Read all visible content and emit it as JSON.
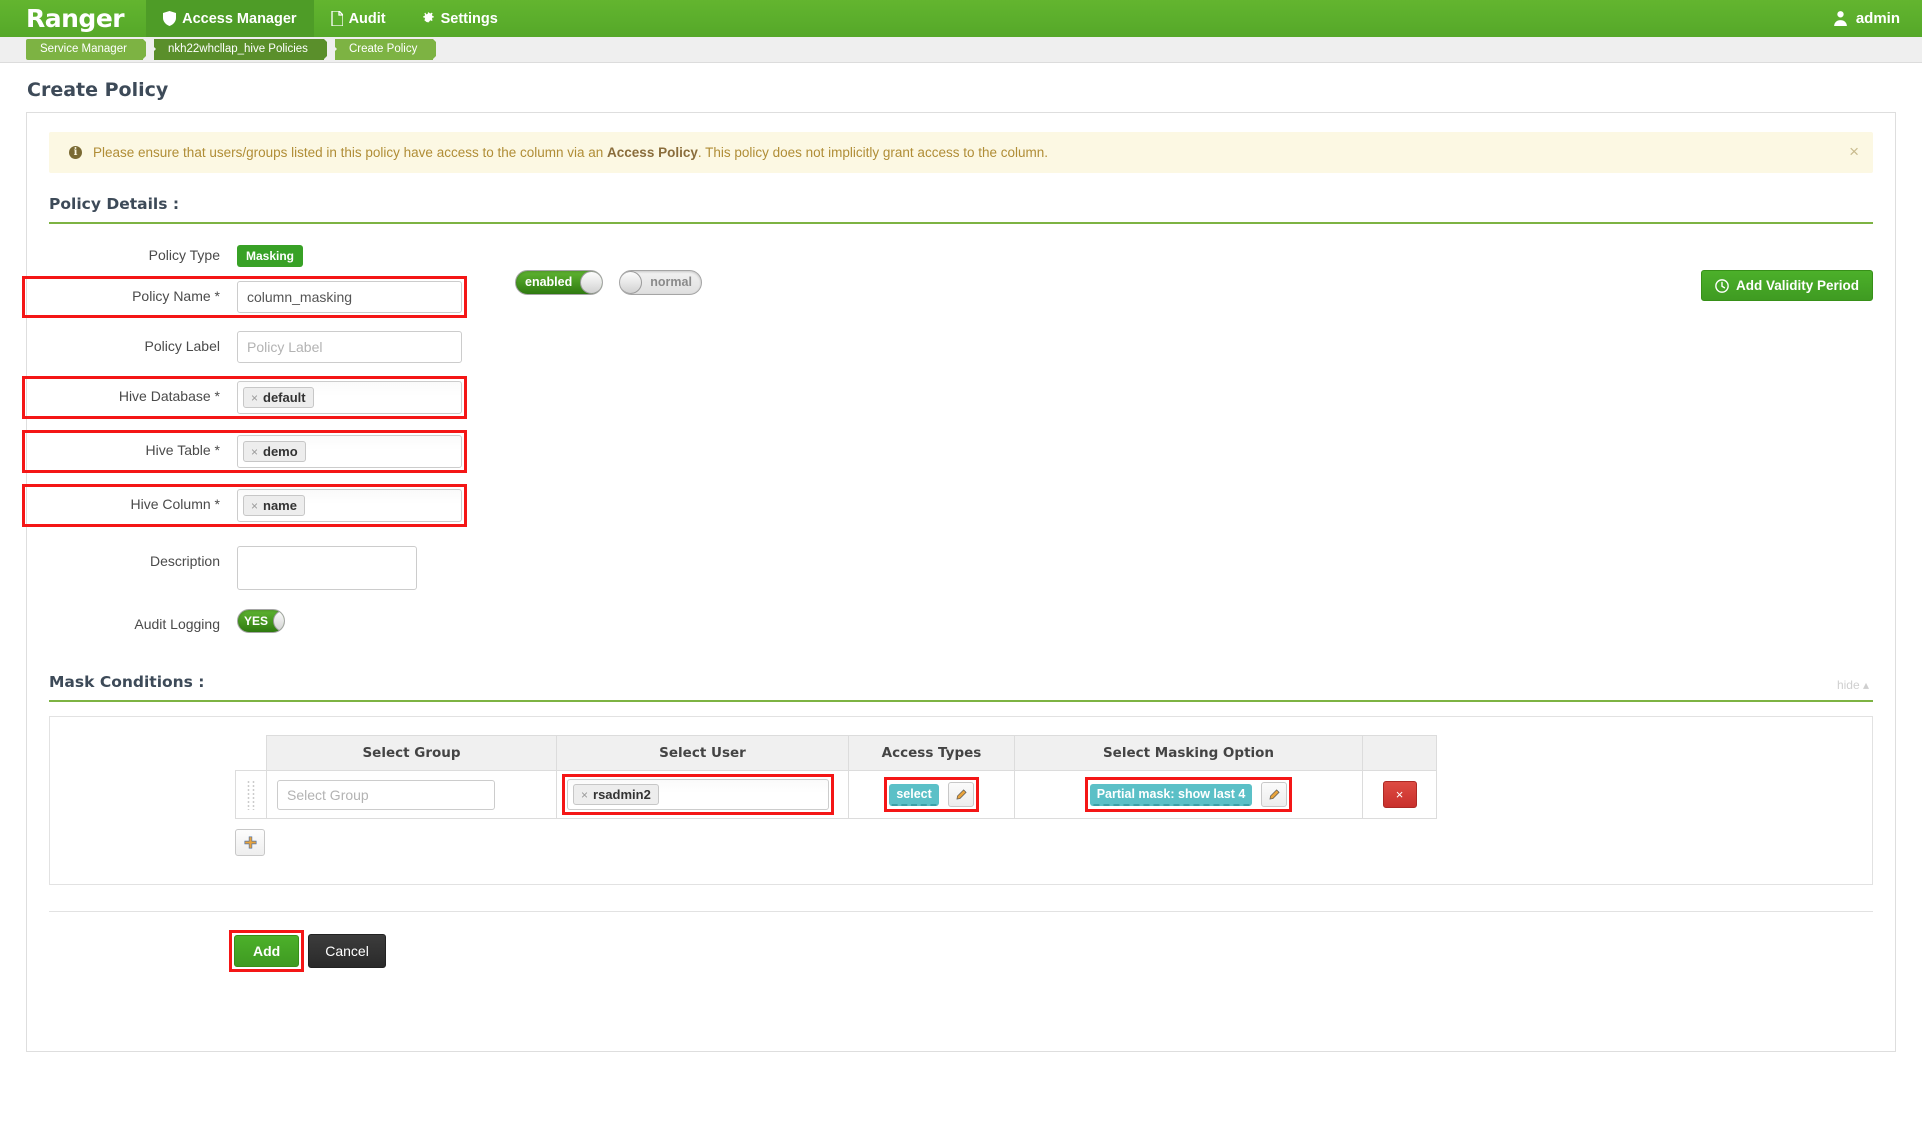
{
  "navbar": {
    "brand": "Ranger",
    "items": [
      {
        "label": "Access Manager",
        "icon": "shield-icon",
        "active": true
      },
      {
        "label": "Audit",
        "icon": "file-icon",
        "active": false
      },
      {
        "label": "Settings",
        "icon": "gear-icon",
        "active": false
      }
    ],
    "user": "admin",
    "user_icon": "user-tie-icon"
  },
  "breadcrumb": {
    "items": [
      "Service Manager",
      "nkh22whcllap_hive Policies",
      "Create Policy"
    ]
  },
  "page": {
    "title": "Create Policy"
  },
  "alert": {
    "text_before": "Please ensure that users/groups listed in this policy have access to the column via an ",
    "link": "Access Policy",
    "text_after": ". This policy does not implicitly grant access to the column.",
    "close": "×",
    "icon": "info-icon"
  },
  "policy_details": {
    "heading": "Policy Details :",
    "policy_type_label": "Policy Type",
    "policy_type_value": "Masking",
    "policy_name_label": "Policy Name *",
    "policy_name_value": "column_masking",
    "policy_label_label": "Policy Label",
    "policy_label_placeholder": "Policy Label",
    "policy_label_value": "",
    "hive_database_label": "Hive Database *",
    "hive_database_token": "default",
    "hive_table_label": "Hive Table *",
    "hive_table_token": "demo",
    "hive_column_label": "Hive Column *",
    "hive_column_token": "name",
    "description_label": "Description",
    "description_value": "",
    "audit_logging_label": "Audit Logging",
    "audit_logging_value": "YES",
    "toggle_enabled": "enabled",
    "toggle_normal": "normal",
    "add_validity_period": "Add Validity Period",
    "token_remove": "×"
  },
  "mask_conditions": {
    "heading": "Mask Conditions :",
    "hide_link": "hide",
    "columns": [
      "Select Group",
      "Select User",
      "Access Types",
      "Select Masking Option",
      ""
    ],
    "rows": [
      {
        "select_group_placeholder": "Select Group",
        "select_group_value": "",
        "select_user_token": "rsadmin2",
        "access_type_badge": "select",
        "masking_option_badge": "Partial mask: show last 4",
        "delete_label": "×",
        "edit_icon": "pencil-icon",
        "grip_icon": "drag-handle-icon"
      }
    ],
    "add_row_label": "+"
  },
  "footer": {
    "add_label": "Add",
    "cancel_label": "Cancel"
  },
  "colors": {
    "brand_green": "#5eb22e",
    "crumb_green": "#7db343",
    "crumb_dark": "#5a8f2b",
    "alert_bg": "#fcf8e3",
    "highlight_red": "#f41616",
    "badge_teal": "#5bc0c7",
    "danger_red": "#c9302c"
  }
}
